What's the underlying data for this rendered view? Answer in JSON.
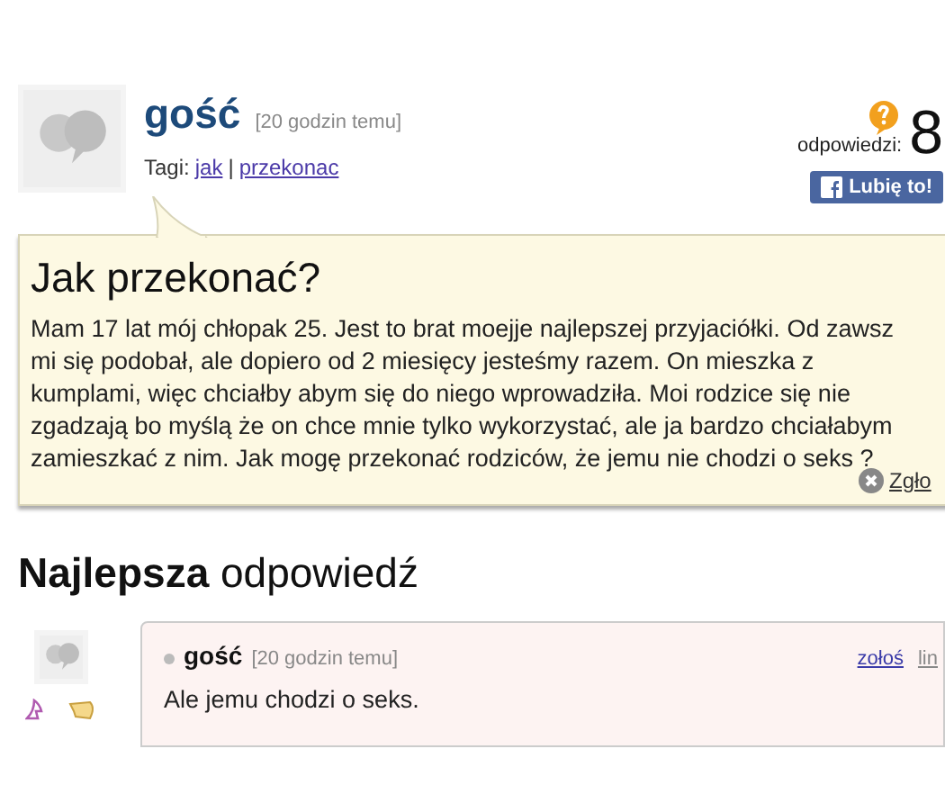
{
  "question": {
    "author": "gość",
    "time": "[20 godzin temu]",
    "tags_label": "Tagi:",
    "tags": [
      "jak",
      "przekonac"
    ],
    "tag_separator": "|",
    "answers_label": "odpowiedzi:",
    "answers_count": "8",
    "like_button": "Lubię to!",
    "title": "Jak przekonać?",
    "body": "Mam 17 lat mój chłopak 25. Jest to brat moejje najlepszej przyjaciółki. Od zawsz\nmi się podobał, ale dopiero od 2 miesięcy jesteśmy razem. On mieszka z\nkumplami, więc chciałby abym się do niego wprowadziła. Moi rodzice się nie\nzgadzają bo myślą że on chce mnie tylko wykorzystać, ale ja bardzo chciałabym\nzamieszkać z nim. Jak mogę przekonać rodziców, że jemu nie chodzi o seks ?",
    "report": "Zgło"
  },
  "best_answer": {
    "heading": "**Najlepsza** odpowiedź",
    "author": "gość",
    "time": "[20 godzin temu]",
    "links": [
      "zołoś",
      "lin"
    ],
    "body": "Ale jemu chodzi o seks."
  }
}
